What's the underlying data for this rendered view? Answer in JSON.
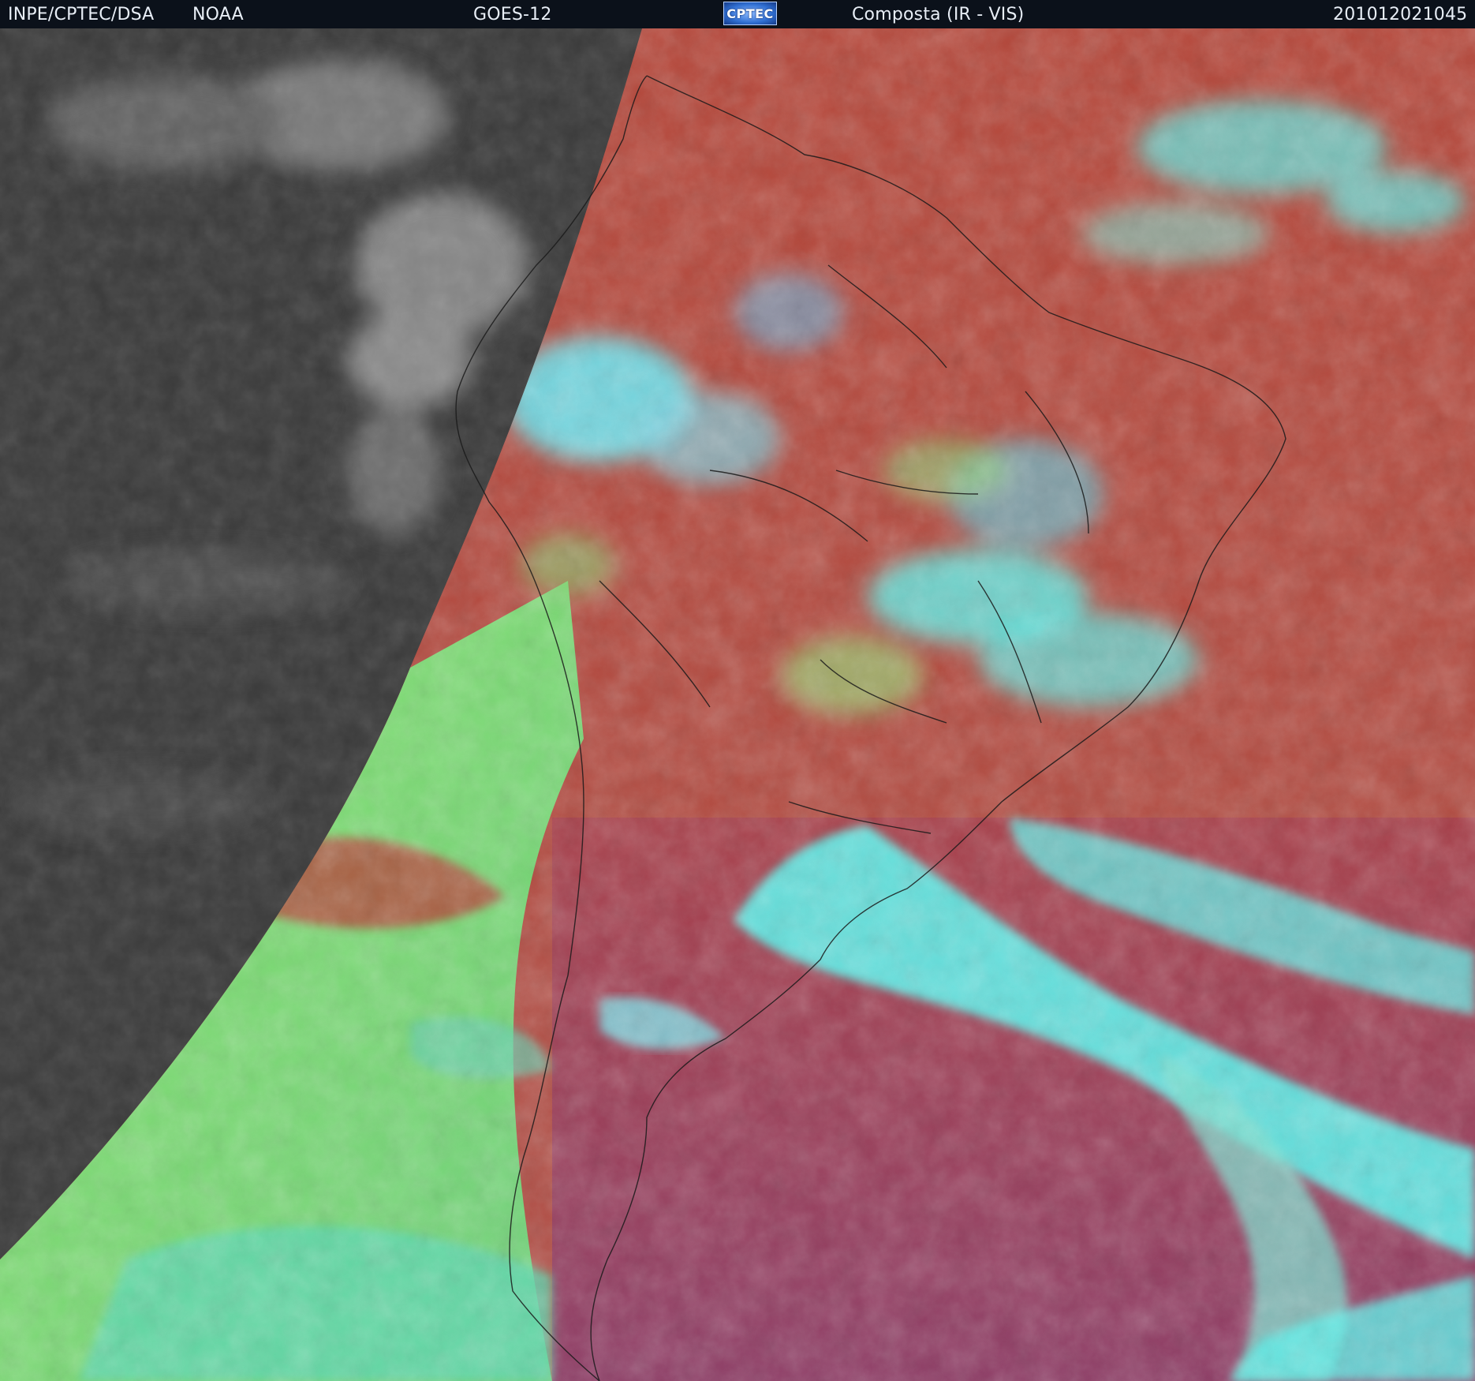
{
  "header": {
    "agency": "INPE/CPTEC/DSA",
    "provider": "NOAA",
    "satellite": "GOES-12",
    "logo_text": "CPTEC",
    "product": "Composta (IR - VIS)",
    "timestamp": "201012021045"
  },
  "colors": {
    "header_bg": "#0b111a",
    "night_side": "#3a3a3a",
    "land_warm": "#b5473a",
    "ocean_south": "#9a3f5a",
    "low_cloud": "#7fd86a",
    "high_cloud": "#5ef0ea",
    "borders": "#1a1a1a"
  }
}
